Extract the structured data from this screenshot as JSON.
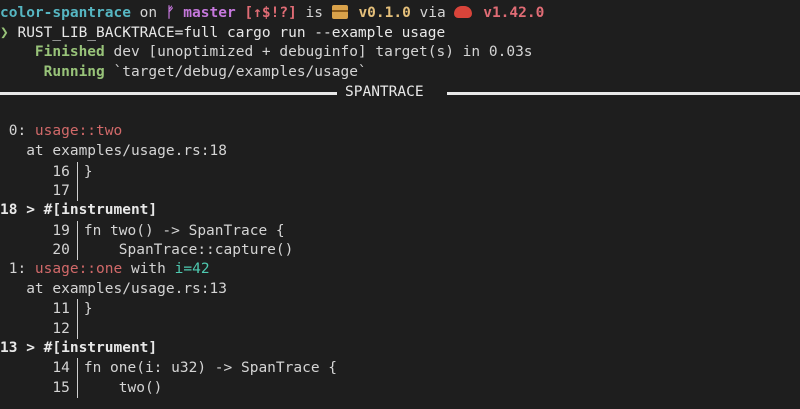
{
  "prompt": {
    "dir": "color-spantrace",
    "on": " on ",
    "branch_glyph": "ᚠ",
    "branch": " master",
    "status": " [↑$!?]",
    "is": " is ",
    "version": " v0.1.0",
    "via": " via ",
    "rust": " v1.42.0"
  },
  "command": {
    "arrow": "❯",
    "text": " RUST_LIB_BACKTRACE=full cargo run --example usage"
  },
  "finished": {
    "label": "Finished",
    "text": " dev [unoptimized + debuginfo] target(s) in 0.03s"
  },
  "running": {
    "label": "Running",
    "text": " `target/debug/examples/usage`"
  },
  "header": {
    "label": "SPANTRACE"
  },
  "frames": [
    {
      "index": " 0: ",
      "name": "usage::two",
      "with": "",
      "field": "",
      "location": "   at examples/usage.rs:18",
      "ctx_before": [
        {
          "no": "      16",
          "code": "}"
        },
        {
          "no": "      17",
          "code": ""
        }
      ],
      "current": {
        "no": "18",
        "code": " > #[instrument]"
      },
      "ctx_after": [
        {
          "no": "      19",
          "code": "fn two() -> SpanTrace {"
        },
        {
          "no": "      20",
          "code": "    SpanTrace::capture()"
        }
      ]
    },
    {
      "index": " 1: ",
      "name": "usage::one",
      "with": " with ",
      "field": "i=42",
      "location": "   at examples/usage.rs:13",
      "ctx_before": [
        {
          "no": "      11",
          "code": "}"
        },
        {
          "no": "      12",
          "code": ""
        }
      ],
      "current": {
        "no": "13",
        "code": " > #[instrument]"
      },
      "ctx_after": [
        {
          "no": "      14",
          "code": "fn one(i: u32) -> SpanTrace {"
        },
        {
          "no": "      15",
          "code": "    two()"
        }
      ]
    }
  ],
  "colors": {
    "background": "#1e1e1e",
    "dir": "#56b6c2",
    "branch": "#c678dd",
    "status": "#e06c75",
    "version": "#e5c07b",
    "rust": "#e06c75",
    "success": "#98c379",
    "span_name": "#d16969",
    "field": "#4ec9b0"
  }
}
